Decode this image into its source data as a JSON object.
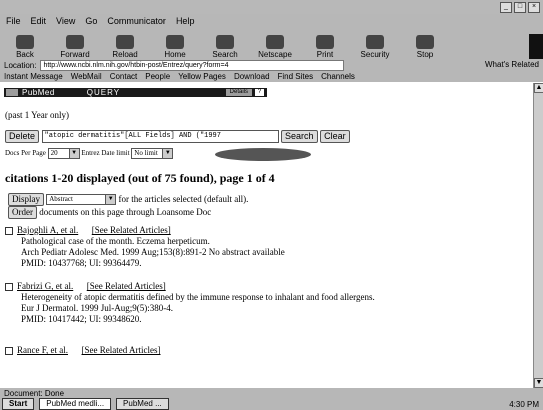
{
  "browser": {
    "menu": [
      "File",
      "Edit",
      "View",
      "Go",
      "Communicator",
      "Help"
    ],
    "toolbar": [
      "Back",
      "Forward",
      "Reload",
      "Home",
      "Search",
      "Netscape",
      "Print",
      "Security",
      "Stop"
    ],
    "location_label": "Location:",
    "location_url": "http://www.ncbi.nlm.nih.gov/htbin-post/Entrez/query?form=4",
    "whats_related": "What's Related",
    "bookmarks": [
      "Instant Message",
      "WebMail",
      "Contact",
      "People",
      "Yellow Pages",
      "Download",
      "Find Sites",
      "Channels"
    ],
    "status": "Document: Done",
    "taskbar": [
      "Start",
      "PubMed medli...",
      "PubMed ..."
    ],
    "clock": "4:30 PM"
  },
  "page": {
    "query_bar": {
      "db": "PubMed",
      "label": "QUERY",
      "button": "Details",
      "help": "?"
    },
    "past_year": "(past 1 Year only)",
    "search_field": "\"atopic dermatitis\"[ALL Fields] AND (\"1997",
    "search_button": "Search",
    "clear_button": "Clear",
    "docs_per_page_label": "Docs Per Page",
    "docs_per_page_value": "20",
    "entrez_date_label": "Entrez Date limit",
    "entrez_date_value": "No limit",
    "result_heading": "citations 1-20 displayed (out of 75 found), page 1 of 4",
    "display_button": "Display",
    "display_format": "Abstract",
    "display_note": "for the articles selected (default all).",
    "order_button": "Order",
    "order_note": "documents on this page through Loansome Doc",
    "citations": [
      {
        "authors": "Bajoghli A, et al.",
        "related": "[See Related Articles]",
        "title": "Pathological case of the month. Eczema herpeticum.",
        "source": "Arch Pediatr Adolesc Med. 1999 Aug;153(8):891-2  No abstract available",
        "ids": "PMID: 10437768; UI: 99364479."
      },
      {
        "authors": "Fabrizi G, et al.",
        "related": "[See Related Articles]",
        "title": "Heterogeneity of atopic dermatitis defined by the immune response to inhalant and food allergens.",
        "source": "Eur J Dermatol. 1999 Jul-Aug;9(5):380-4.",
        "ids": "PMID: 10417442; UI: 99348620."
      },
      {
        "authors": "Rance F, et al.",
        "related": "[See Related Articles]",
        "title": "",
        "source": "",
        "ids": ""
      }
    ]
  }
}
